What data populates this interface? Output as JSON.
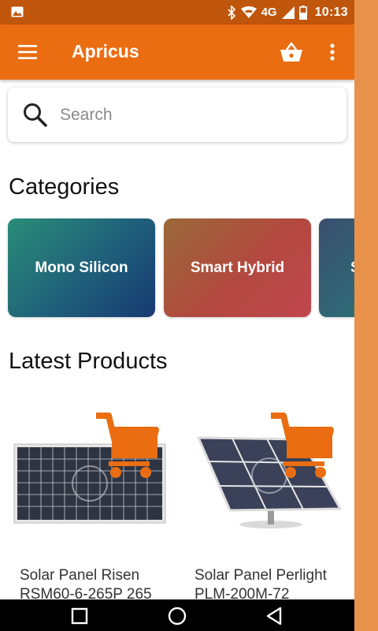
{
  "status_bar": {
    "network": "4G",
    "time": "10:13",
    "left_icon": "image-icon",
    "icons": [
      "bluetooth-icon",
      "wifi-icon",
      "signal-icon",
      "battery-icon"
    ]
  },
  "app_bar": {
    "title": "Apricus",
    "menu_icon": "menu-icon",
    "cart_icon": "basket-icon",
    "more_icon": "more-vert-icon"
  },
  "search": {
    "placeholder": "Search",
    "value": ""
  },
  "categories": {
    "heading": "Categories",
    "items": [
      {
        "label": "Mono Silicon"
      },
      {
        "label": "Smart Hybrid"
      },
      {
        "label": "S"
      }
    ]
  },
  "latest_products": {
    "heading": "Latest Products",
    "items": [
      {
        "name": "Solar Panel Risen RSM60-6-265P 265"
      },
      {
        "name": "Solar Panel Perlight PLM-200M-72"
      }
    ]
  },
  "nav_bar": {
    "buttons": [
      "recent-apps-icon",
      "home-icon",
      "back-icon"
    ]
  },
  "colors": {
    "status_bar": "#c0560c",
    "app_bar": "#ea6d12",
    "accent": "#e8914b",
    "cart_overlay": "#ea6d12"
  }
}
